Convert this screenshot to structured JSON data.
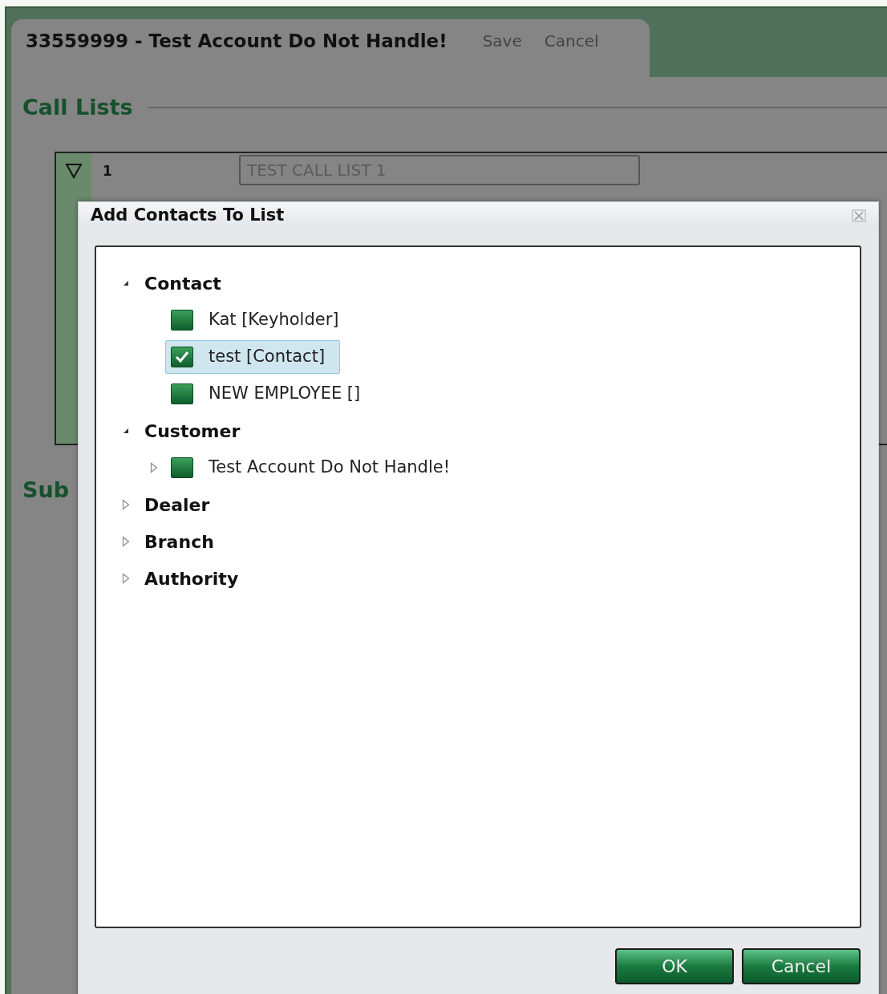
{
  "page": {
    "title": "33559999 - Test Account Do Not Handle!",
    "actions": [
      "Save",
      "Cancel"
    ],
    "section": "Call Lists",
    "call_list": {
      "number": "1",
      "expanded": true,
      "name": "TEST CALL LIST 1"
    },
    "section_2": "Sub"
  },
  "dialog": {
    "title": "Add Contacts To List",
    "tree": [
      {
        "kind": "group",
        "label": "Contact",
        "expanded": true,
        "children": [
          {
            "kind": "item",
            "label": "Kat [Keyholder]",
            "checked": false,
            "selected": false
          },
          {
            "kind": "item",
            "label": "test [Contact]",
            "checked": true,
            "selected": true
          },
          {
            "kind": "item",
            "label": "NEW EMPLOYEE []",
            "checked": false,
            "selected": false
          }
        ]
      },
      {
        "kind": "group",
        "label": "Customer",
        "expanded": true,
        "children": [
          {
            "kind": "item",
            "label": "Test Account Do Not Handle!",
            "checked": false,
            "selected": false,
            "expanded": false
          }
        ]
      },
      {
        "kind": "group",
        "label": "Dealer",
        "expanded": false
      },
      {
        "kind": "group",
        "label": "Branch",
        "expanded": false
      },
      {
        "kind": "group",
        "label": "Authority",
        "expanded": false
      }
    ],
    "buttons": [
      "OK",
      "Cancel"
    ]
  }
}
